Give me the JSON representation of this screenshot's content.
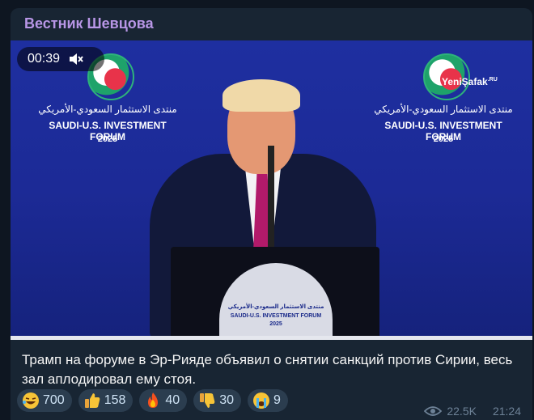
{
  "channel": {
    "name": "Вестник Шевцова"
  },
  "video": {
    "timer": "00:39",
    "forum": {
      "arabic_title": "منتدى الاستثمار السعودي-الأمريكي",
      "english_title": "SAUDI-U.S. INVESTMENT FORUM",
      "year": "2025"
    },
    "watermark": {
      "brand": "YeniŞafak",
      "suffix": ".RU"
    }
  },
  "message": {
    "text": "Трамп на форуме в Эр-Рияде объявил о снятии санкций против Сирии, весь зал аплодировал ему стоя."
  },
  "reactions": [
    {
      "emoji": "rofl-emoji",
      "count": "700"
    },
    {
      "emoji": "thumbs-up-emoji",
      "count": "158"
    },
    {
      "emoji": "fire-emoji",
      "count": "40"
    },
    {
      "emoji": "thumbs-down-emoji",
      "count": "30"
    },
    {
      "emoji": "crying-emoji",
      "count": "9"
    }
  ],
  "meta": {
    "views": "22.5K",
    "time": "21:24"
  },
  "colors": {
    "background": "#0e1621",
    "bubble": "#182533",
    "channel_name": "#b896e6",
    "reaction_bg": "#2b3d4f",
    "meta": "#6d8196"
  }
}
